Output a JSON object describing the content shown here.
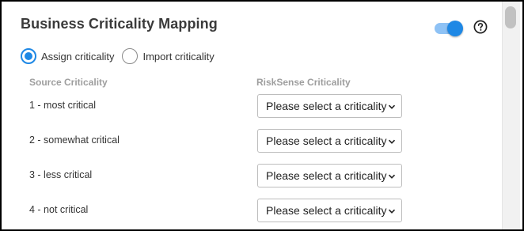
{
  "panel": {
    "title": "Business Criticality Mapping",
    "toggle_on": true,
    "accent_color": "#1e88e5"
  },
  "icons": {
    "help": "help-circle-icon",
    "select_chevron": "chevron-down-icon"
  },
  "radios": [
    {
      "label": "Assign criticality",
      "selected": true
    },
    {
      "label": "Import criticality",
      "selected": false
    }
  ],
  "columns": {
    "source": "Source Criticality",
    "risksense": "RiskSense Criticality"
  },
  "rows": [
    {
      "label": "1 - most critical",
      "select_value": "Please select a criticality"
    },
    {
      "label": "2 - somewhat critical",
      "select_value": "Please select a criticality"
    },
    {
      "label": "3 - less critical",
      "select_value": "Please select a criticality"
    },
    {
      "label": "4 - not critical",
      "select_value": "Please select a criticality"
    }
  ]
}
